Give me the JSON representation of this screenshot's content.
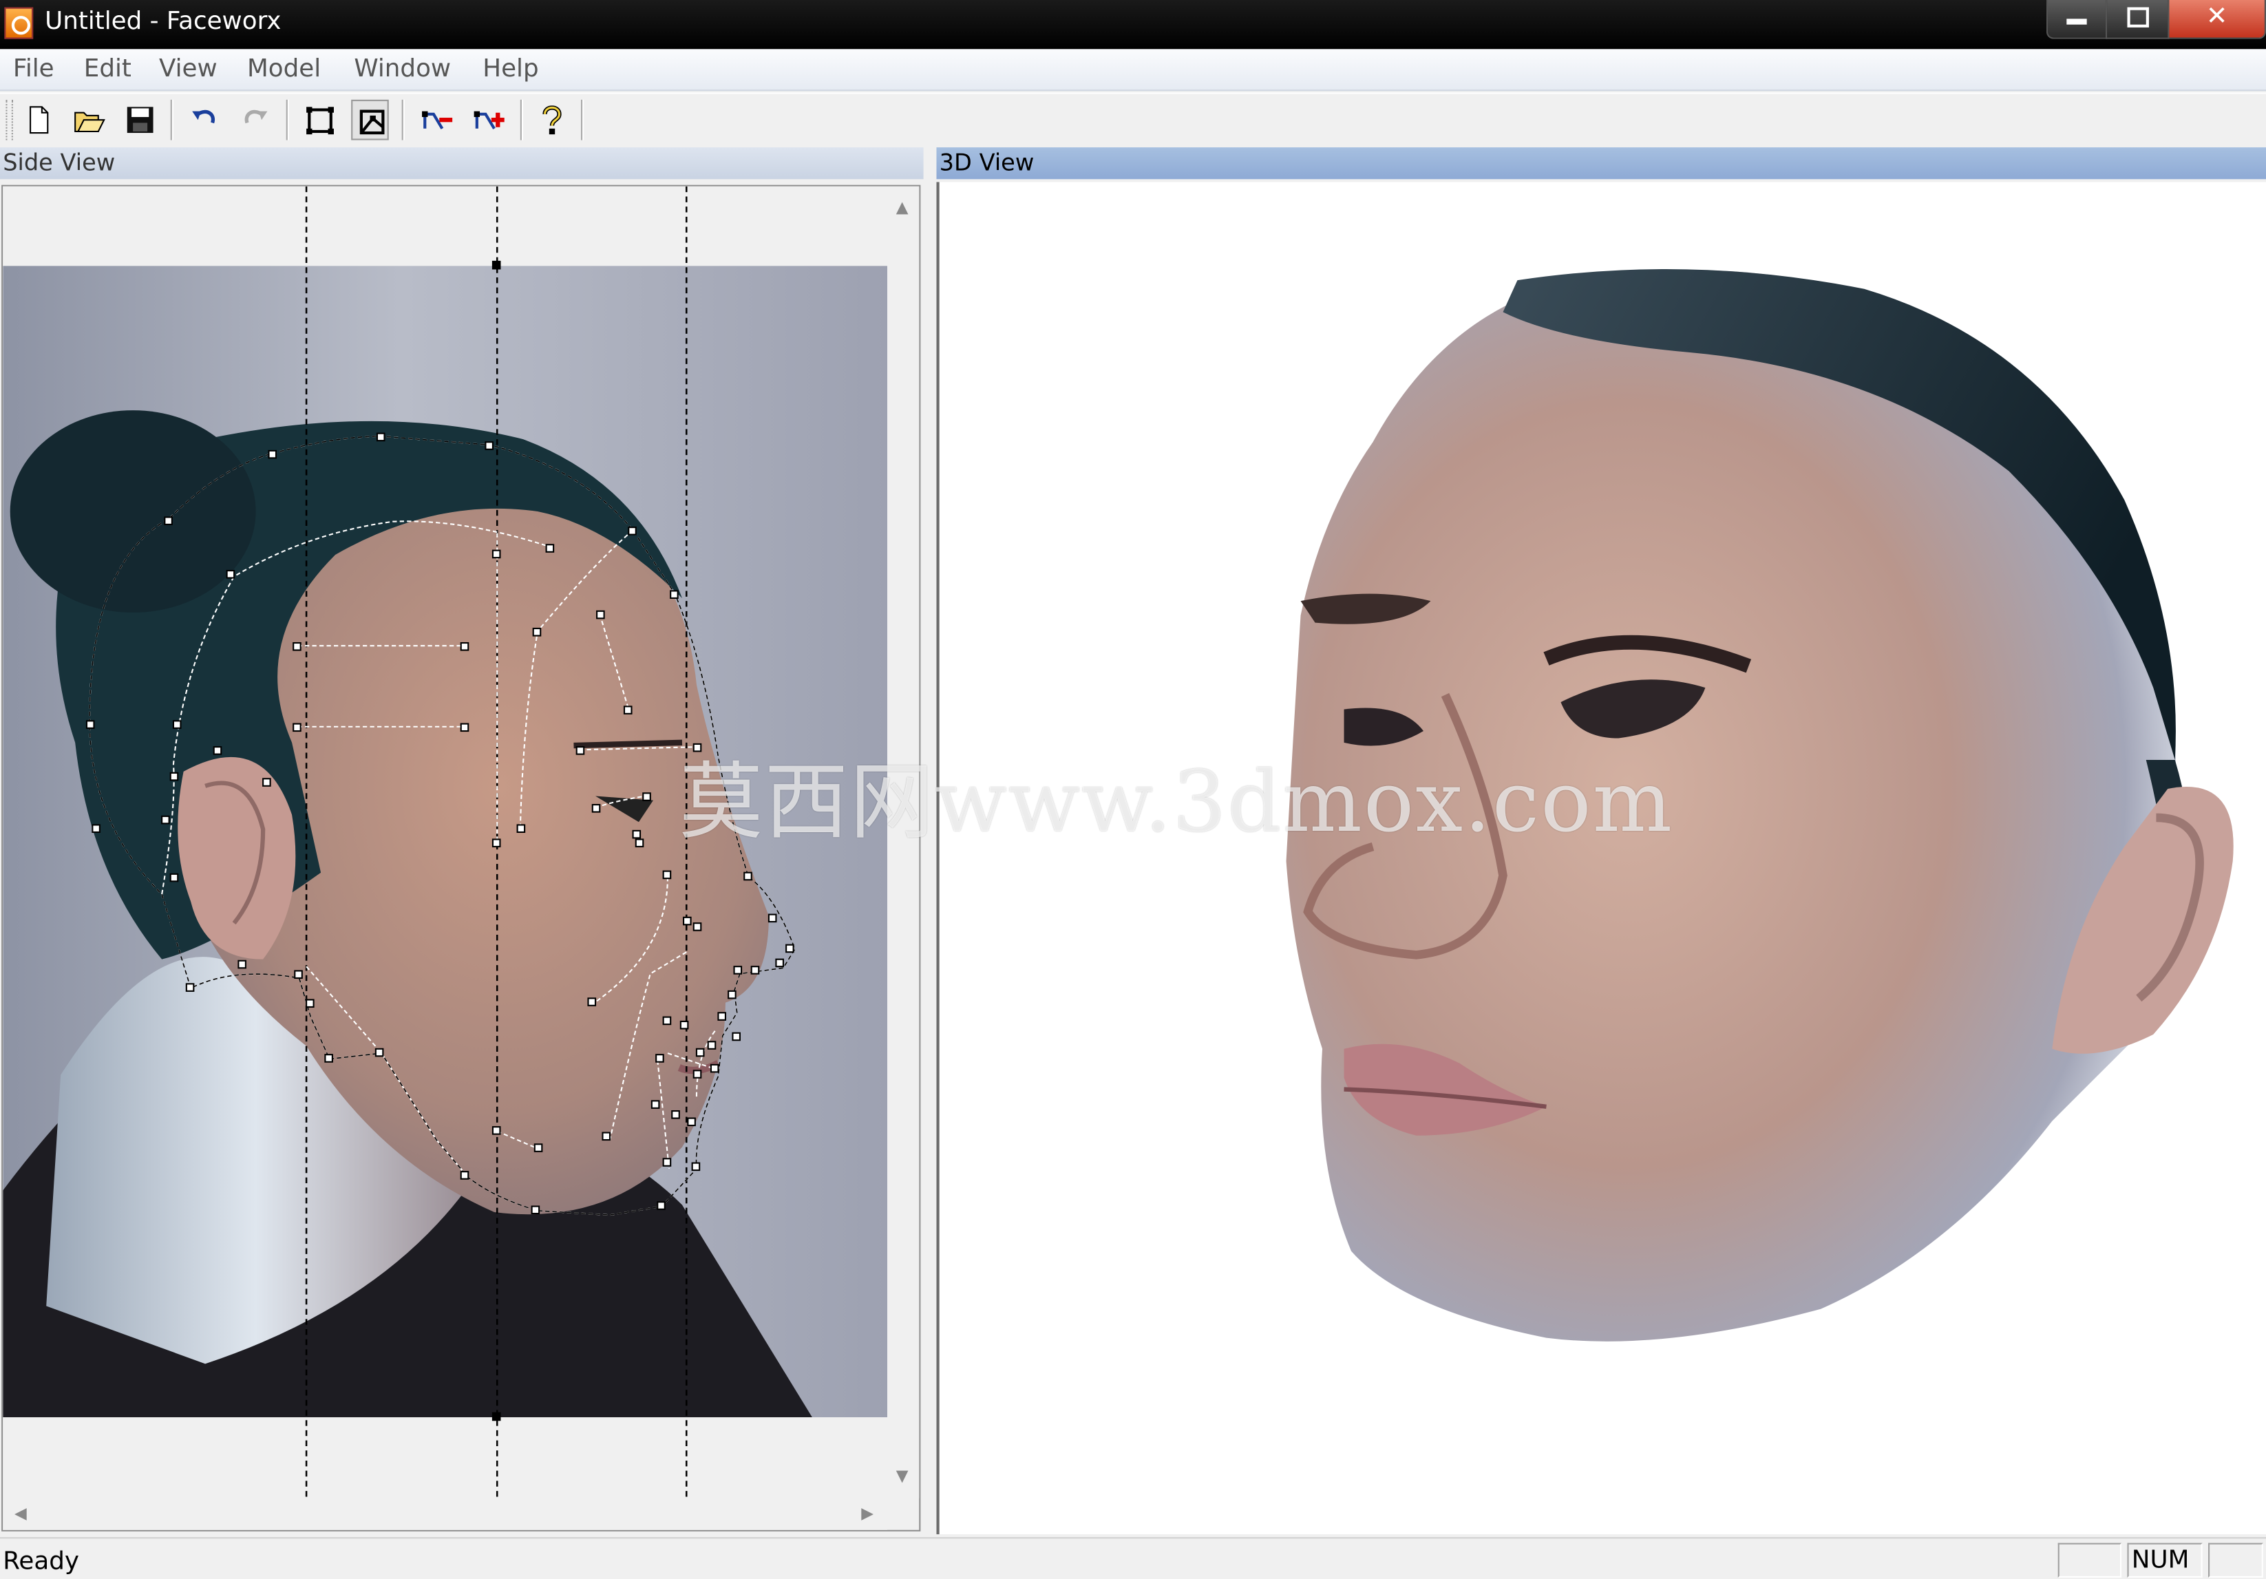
{
  "window": {
    "title": "Untitled - Faceworx"
  },
  "menu": [
    "File",
    "Edit",
    "View",
    "Model",
    "Window",
    "Help"
  ],
  "toolbar": {
    "buttons": [
      "new-file-icon",
      "open-folder-icon",
      "save-disk-icon",
      "undo-icon",
      "redo-icon",
      "frame-view-icon",
      "point-edit-icon",
      "add-point-horizontal-icon",
      "add-point-icon",
      "help-icon"
    ]
  },
  "side_view": {
    "title": "Side View"
  },
  "view_3d": {
    "title": "3D View"
  },
  "watermark": "莫西网www.3dmox.com",
  "status": {
    "text": "Ready",
    "num": "NUM"
  },
  "colors": {
    "titlebar": "#000000",
    "header_3d": "#8eaad5",
    "header_side": "#c9d3e3",
    "close_button": "#c3331e"
  }
}
